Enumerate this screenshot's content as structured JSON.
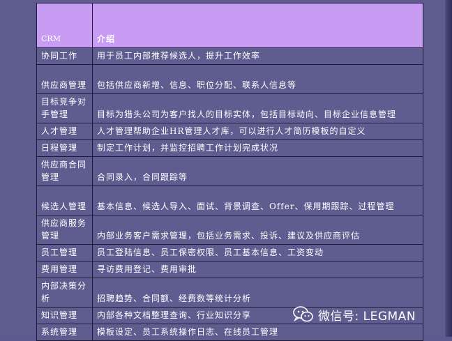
{
  "table": {
    "header": {
      "col1": "CRM",
      "col2": "介绍"
    },
    "rows": [
      {
        "name": "协同工作",
        "desc": "用于员工内部推荐候选人，提升工作效率"
      },
      {
        "name": "供应商管理",
        "desc": "包括供应商新增、信息、职位分配、联系人信息等"
      },
      {
        "name": "目标竞争对手管理",
        "desc": "目标为猎头公司为客户找人的目标实体，包括目标动向、目标企业信息管理"
      },
      {
        "name": "人才管理",
        "desc": "人才管理帮助企业HR管理人才库，可以进行人才简历模板的自定义"
      },
      {
        "name": "日程管理",
        "desc": "制定工作计划，并监控招聘工作计划完成状况"
      },
      {
        "name": "供应商合同管理",
        "desc": "合同录入，合同跟踪等"
      },
      {
        "name": "候选人管理",
        "desc": "基本信息、候选人导入、面试、背景调查、Offer、保用期跟踪、过程管理"
      },
      {
        "name": "供应商服务管理",
        "desc": "内部业务客户需求管理，包括业务需求、投诉、建议及供应商评估"
      },
      {
        "name": "员工管理",
        "desc": "员工登陆信息、员工保密权限、员工基本信息、工资变动"
      },
      {
        "name": "费用管理",
        "desc": "寻访费用登记、费用审批"
      },
      {
        "name": "内部决策分析",
        "desc": "招聘趋势、合同额、经费数等统计分析"
      },
      {
        "name": "知识管理",
        "desc": "内部各种文档整理查询、行业知识分享"
      },
      {
        "name": "系统管理",
        "desc": "模板设定、员工系统操作日志、在线员工管理"
      }
    ]
  },
  "watermark": {
    "text": "微信号: LEGMAN",
    "icon": "wechat-icon"
  }
}
